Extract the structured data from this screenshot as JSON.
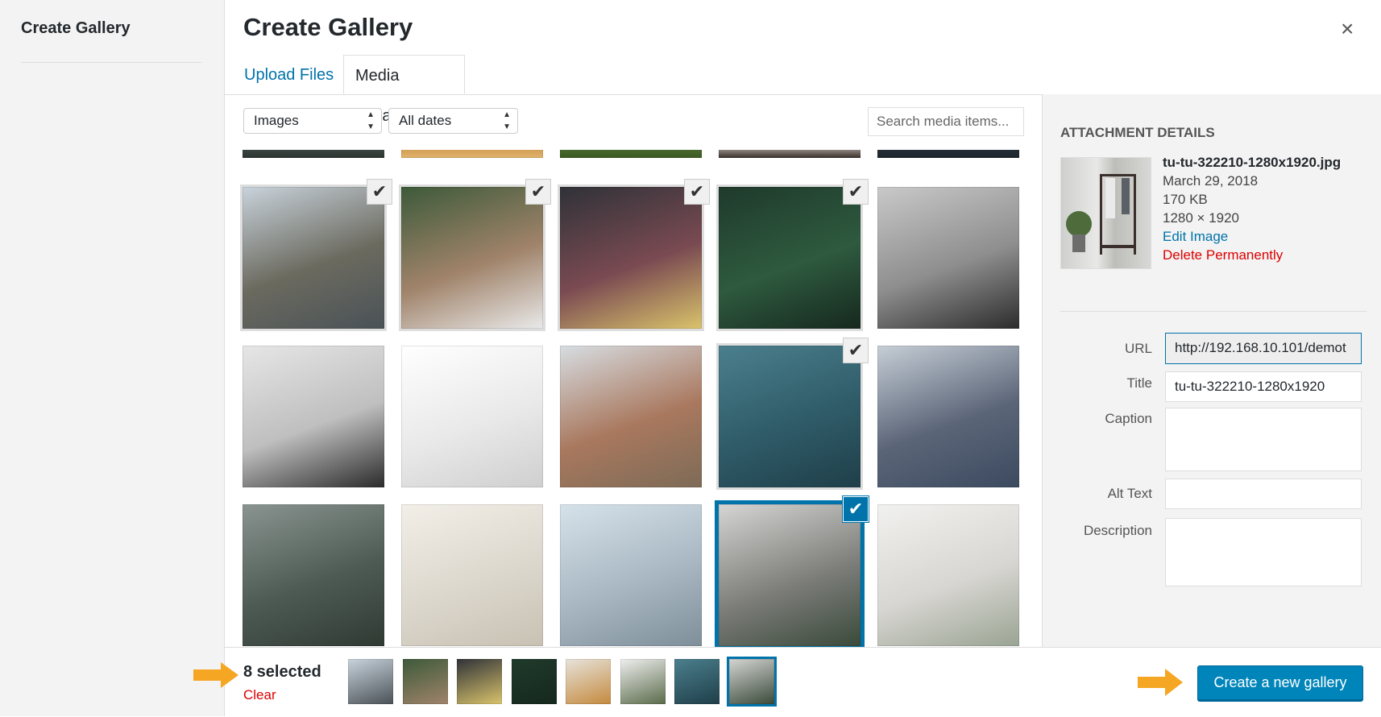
{
  "sidebar": {
    "title": "Create Gallery"
  },
  "modal": {
    "title": "Create Gallery",
    "close": "×"
  },
  "tabs": [
    {
      "label": "Upload Files"
    },
    {
      "label": "Media Library"
    }
  ],
  "filters": {
    "type_value": "Images",
    "date_value": "All dates",
    "search_placeholder": "Search media items..."
  },
  "grid": {
    "items": [
      {
        "desc": "fisherman-lake",
        "selected": true,
        "colors": [
          "#c9d3dc",
          "#6b6a5f",
          "#4a5257"
        ]
      },
      {
        "desc": "coffee-notebook",
        "selected": true,
        "colors": [
          "#3d5a3a",
          "#a0836a",
          "#e9e9e9"
        ]
      },
      {
        "desc": "food-platter",
        "selected": true,
        "colors": [
          "#2f3238",
          "#7a4a52",
          "#d9c36b"
        ]
      },
      {
        "desc": "forest-aerial",
        "selected": true,
        "colors": [
          "#1f3a2b",
          "#2e5a3f",
          "#16281e"
        ]
      },
      {
        "desc": "fallmag-street",
        "selected": false,
        "colors": [
          "#c9c9c9",
          "#8e8e8e",
          "#2c2c2c"
        ]
      },
      {
        "desc": "laptop-phone",
        "selected": false,
        "colors": [
          "#e6e6e6",
          "#bfbfbf",
          "#2b2b2b"
        ]
      },
      {
        "desc": "empire-state",
        "selected": false,
        "colors": [
          "#ffffff",
          "#e9e9e9",
          "#cfcfcf"
        ]
      },
      {
        "desc": "snow-monkeys",
        "selected": false,
        "colors": [
          "#d7dde2",
          "#a9785e",
          "#7d6b57"
        ]
      },
      {
        "desc": "sparkler-water",
        "selected": true,
        "colors": [
          "#4b7f8d",
          "#2f5b68",
          "#1f3f49"
        ]
      },
      {
        "desc": "fjord-mountains",
        "selected": false,
        "colors": [
          "#c6ced6",
          "#5b6578",
          "#3c4a5f"
        ]
      },
      {
        "desc": "misty-forest",
        "selected": false,
        "colors": [
          "#8a9491",
          "#4d5a53",
          "#2f3a33"
        ]
      },
      {
        "desc": "white-curtains",
        "selected": false,
        "colors": [
          "#f2efe8",
          "#dcd7cd",
          "#c8c1b3"
        ]
      },
      {
        "desc": "glass-chandelier",
        "selected": false,
        "colors": [
          "#d6e2ea",
          "#a8b7c2",
          "#7f8f9a"
        ]
      },
      {
        "desc": "clothes-rack",
        "selected": true,
        "focus": true,
        "colors": [
          "#d5d5d3",
          "#7e7e7b",
          "#3a4a3a"
        ]
      },
      {
        "desc": "bright-room",
        "selected": false,
        "colors": [
          "#f1f1ef",
          "#d8d6d2",
          "#9aa493"
        ]
      }
    ],
    "partial_row_colors": [
      [
        "#4b5a55",
        "#2c3430"
      ],
      [
        "#c48a3e",
        "#e0b26b"
      ],
      [
        "#5a7a3a",
        "#3a5a22"
      ],
      [
        "#f0ece6",
        "#3a2f2a"
      ],
      [
        "#2f3a44",
        "#1d252c"
      ]
    ]
  },
  "attachment": {
    "heading": "ATTACHMENT DETAILS",
    "filename": "tu-tu-322210-1280x1920.jpg",
    "date": "March 29, 2018",
    "size": "170 KB",
    "dimensions": "1280 × 1920",
    "edit_link": "Edit Image",
    "delete_link": "Delete Permanently",
    "fields": {
      "url_label": "URL",
      "url_value": "http://192.168.10.101/demot",
      "title_label": "Title",
      "title_value": "tu-tu-322210-1280x1920",
      "caption_label": "Caption",
      "caption_value": "",
      "alt_label": "Alt Text",
      "alt_value": "",
      "description_label": "Description",
      "description_value": ""
    }
  },
  "selection": {
    "count_label": "8 selected",
    "clear_label": "Clear",
    "thumbs": [
      {
        "desc": "fisherman-lake",
        "colors": [
          "#c9d3dc",
          "#4a5257"
        ]
      },
      {
        "desc": "coffee-notebook",
        "colors": [
          "#3d5a3a",
          "#a0836a"
        ]
      },
      {
        "desc": "food-platter",
        "colors": [
          "#2f3238",
          "#d9c36b"
        ]
      },
      {
        "desc": "forest-aerial",
        "colors": [
          "#1f3a2b",
          "#16281e"
        ]
      },
      {
        "desc": "room-wood-floor",
        "colors": [
          "#e7e3dc",
          "#c48a3e"
        ]
      },
      {
        "desc": "plant-chair",
        "colors": [
          "#efefef",
          "#5a6b4a"
        ]
      },
      {
        "desc": "sparkler-water",
        "colors": [
          "#4b7f8d",
          "#1f3f49"
        ]
      },
      {
        "desc": "clothes-rack",
        "colors": [
          "#d5d5d3",
          "#3a4a3a"
        ],
        "focus": true
      }
    ]
  },
  "actions": {
    "create_label": "Create a new gallery"
  },
  "colors": {
    "accent": "#0073aa",
    "button": "#0085ba",
    "danger": "#dd0000",
    "arrow": "#f5a623"
  }
}
